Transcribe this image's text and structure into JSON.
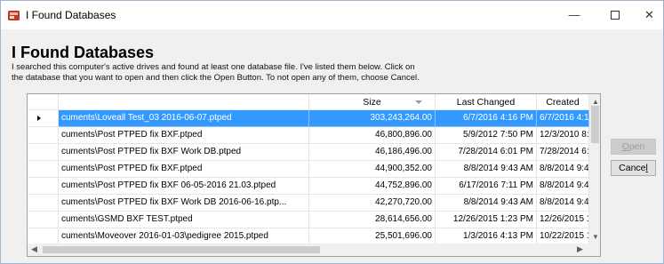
{
  "window": {
    "title": "I Found Databases",
    "minimize": "—",
    "close": "✕"
  },
  "heading": "I Found Databases",
  "description_line1": "I searched this computer's active drives and found at least one database file.  I've listed them below.  Click on",
  "description_line2": "the database that you want to open and then click the Open Button.  To not open any of them, choose Cancel.",
  "table": {
    "columns": [
      "",
      "Size",
      "Last Changed",
      "Created"
    ],
    "rows": [
      {
        "path": "cuments\\Loveall Test_03 2016-06-07.ptped",
        "size": "303,243,264.00",
        "changed": "6/7/2016 4:16 PM",
        "created": "6/7/2016 4:16 PM",
        "selected": true
      },
      {
        "path": "cuments\\Post PTPED fix BXF.ptped",
        "size": "46,800,896.00",
        "changed": "5/9/2012 7:50 PM",
        "created": "12/3/2010 8:51 ..."
      },
      {
        "path": "cuments\\Post PTPED fix BXF Work DB.ptped",
        "size": "46,186,496.00",
        "changed": "7/28/2014 6:01 PM",
        "created": "7/28/2014 6:01 ..."
      },
      {
        "path": "cuments\\Post PTPED fix BXF.ptped",
        "size": "44,900,352.00",
        "changed": "8/8/2014 9:43 AM",
        "created": "8/8/2014 9:43 AM"
      },
      {
        "path": "cuments\\Post PTPED fix BXF 06-05-2016 21.03.ptped",
        "size": "44,752,896.00",
        "changed": "6/17/2016 7:11 PM",
        "created": "8/8/2014 9:43 AM"
      },
      {
        "path": "cuments\\Post PTPED fix BXF Work DB 2016-06-16.ptp...",
        "size": "42,270,720.00",
        "changed": "8/8/2014 9:43 AM",
        "created": "8/8/2014 9:43 AM"
      },
      {
        "path": "cuments\\GSMD BXF TEST.ptped",
        "size": "28,614,656.00",
        "changed": "12/26/2015 1:23 PM",
        "created": "12/26/2015 1:23..."
      },
      {
        "path": "cuments\\Moveover 2016-01-03\\pedigree 2015.ptped",
        "size": "25,501,696.00",
        "changed": "1/3/2016 4:13 PM",
        "created": "10/22/2015 1:25..."
      }
    ]
  },
  "buttons": {
    "open_pre": "",
    "open_u": "O",
    "open_post": "pen",
    "cancel_pre": "Cance",
    "cancel_u": "l",
    "cancel_post": ""
  },
  "colors": {
    "selection": "#3399ff",
    "dialog_bg": "#f0f0f0"
  },
  "icons": [
    "app-icon",
    "row-pointer-icon",
    "sort-descending-icon",
    "scroll-up-icon",
    "scroll-down-icon",
    "scroll-left-icon",
    "scroll-right-icon"
  ]
}
